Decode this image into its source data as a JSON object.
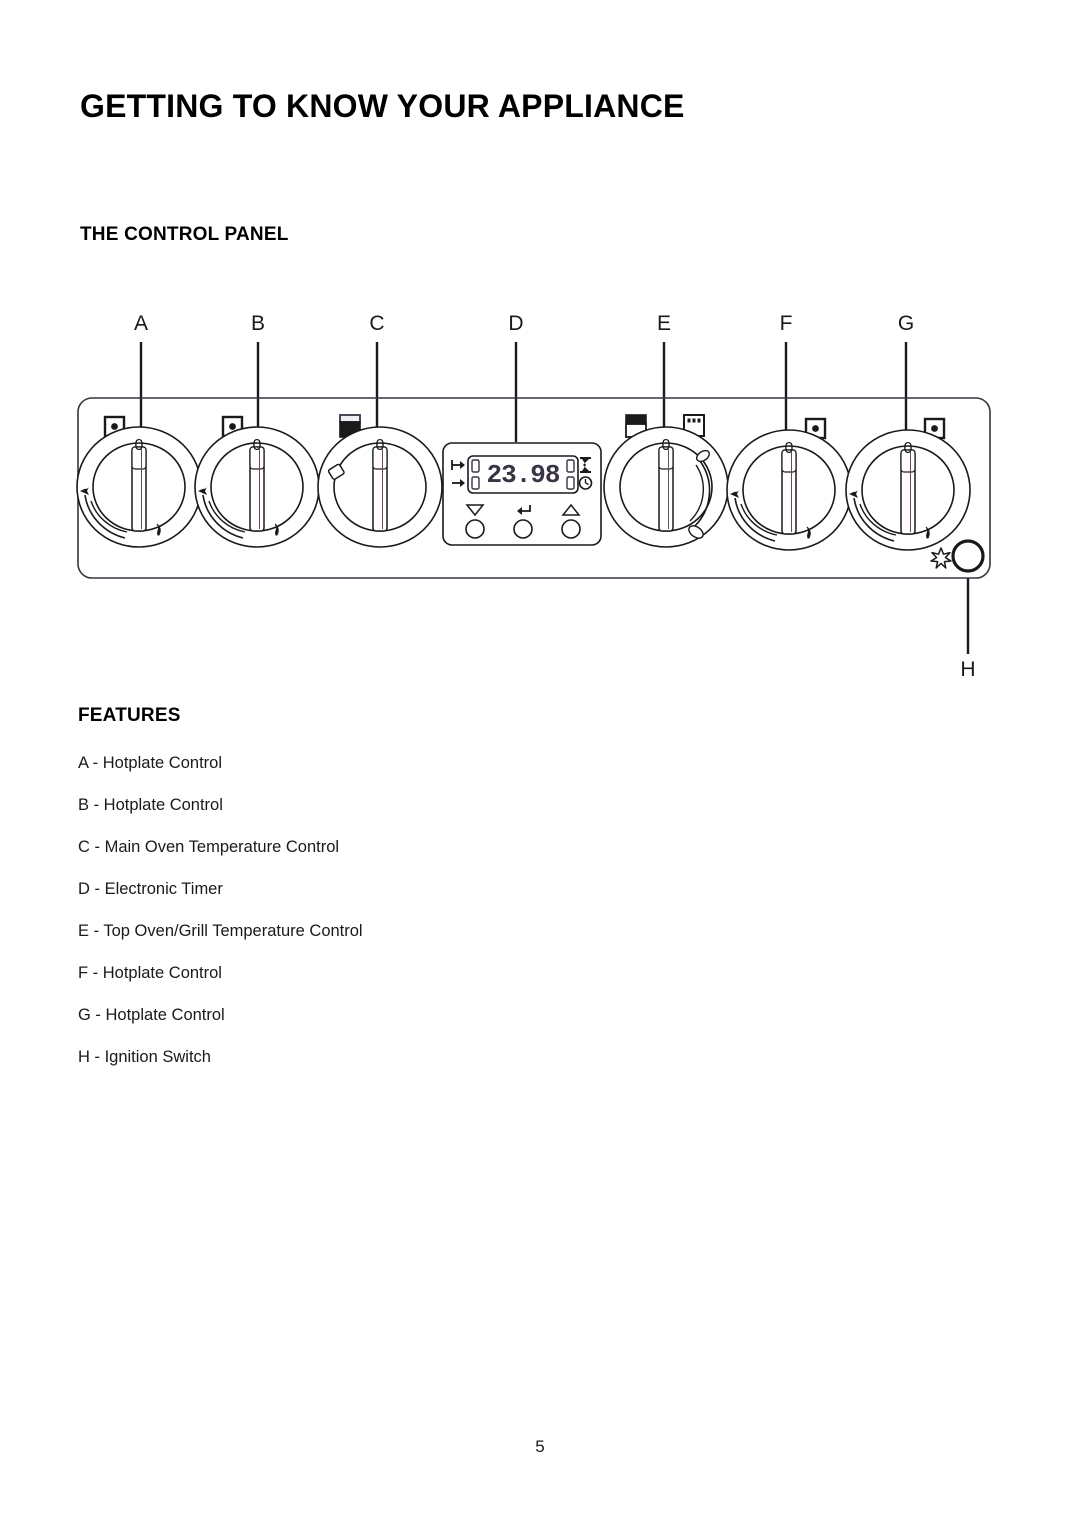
{
  "document": {
    "main_title": "GETTING TO KNOW YOUR APPLIANCE",
    "section_title": "THE CONTROL PANEL",
    "features_title": "FEATURES",
    "page_number": "5"
  },
  "control_panel": {
    "callout_labels": [
      "A",
      "B",
      "C",
      "D",
      "E",
      "F",
      "G"
    ],
    "bottom_callout_label": "H",
    "knobs": [
      {
        "id": "A",
        "type": "hotplate-control",
        "zero_mark": "0",
        "icon": "burner-single-dot-icon",
        "arc_side": "left"
      },
      {
        "id": "B",
        "type": "hotplate-control",
        "zero_mark": "0",
        "icon": "burner-single-dot-icon",
        "arc_side": "left"
      },
      {
        "id": "C",
        "type": "main-oven-temperature-control",
        "zero_mark": "0",
        "icon": "main-oven-icon",
        "arc_side": "none"
      },
      {
        "id": "E",
        "type": "top-oven-grill-temperature-control",
        "zero_mark": "0",
        "icon": "top-oven-icon",
        "icon_secondary": "grill-icon",
        "arc_side": "right"
      },
      {
        "id": "F",
        "type": "hotplate-control",
        "zero_mark": "0",
        "icon": "burner-single-dot-icon",
        "arc_side": "left"
      },
      {
        "id": "G",
        "type": "hotplate-control",
        "zero_mark": "0",
        "icon": "burner-single-dot-icon",
        "arc_side": "left"
      }
    ],
    "timer": {
      "id": "D",
      "type": "electronic-timer",
      "display_value": "23.98",
      "left_indicators": [
        "cook-time-arrow-icon",
        "end-time-arrow-icon"
      ],
      "right_indicators": [
        "hourglass-icon",
        "clock-icon"
      ],
      "buttons": [
        "decrease-button",
        "select-button",
        "increase-button"
      ]
    },
    "ignition": {
      "id": "H",
      "type": "ignition-switch",
      "icon": "spark-icon"
    }
  },
  "features": [
    "A - Hotplate Control",
    "B - Hotplate Control",
    "C - Main Oven Temperature Control",
    "D - Electronic Timer",
    "E - Top Oven/Grill Temperature Control",
    "F - Hotplate Control",
    "G - Hotplate Control",
    "H - Ignition Switch"
  ]
}
